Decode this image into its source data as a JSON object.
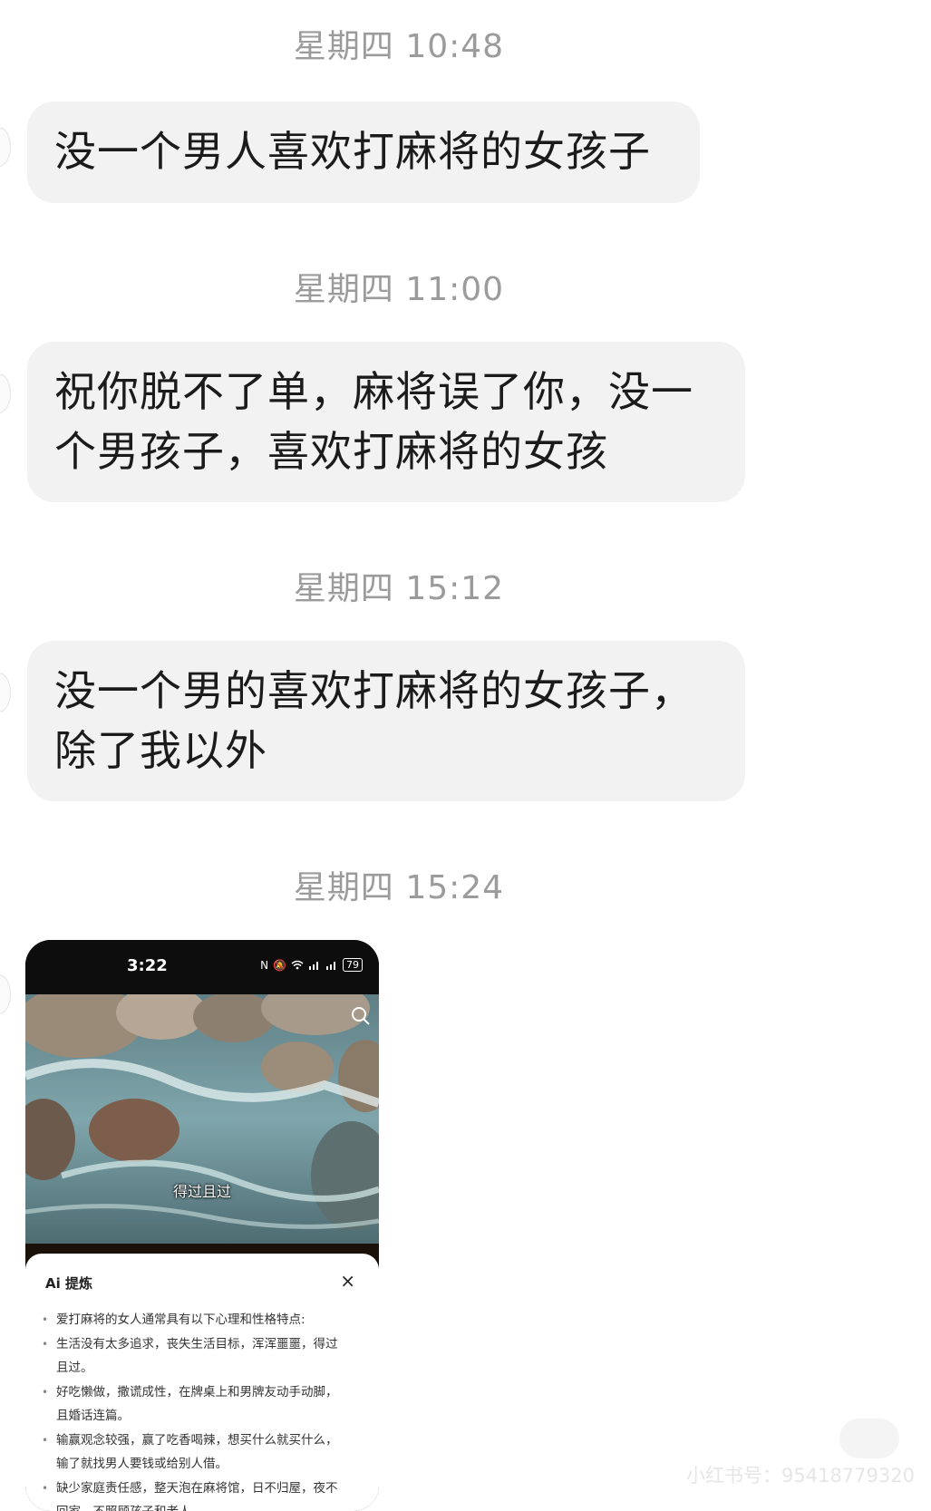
{
  "chat": {
    "messages": [
      {
        "timestamp": "星期四 10:48",
        "text": "没一个男人喜欢打麻将的女孩子"
      },
      {
        "timestamp": "星期四 11:00",
        "text": "祝你脱不了单，麻将误了你，没一个男孩子，喜欢打麻将的女孩"
      },
      {
        "timestamp": "星期四 15:12",
        "text": "没一个男的喜欢打麻将的女孩子，除了我以外"
      },
      {
        "timestamp": "星期四 15:24"
      }
    ]
  },
  "screenshot": {
    "status_time": "3:22",
    "battery": "79",
    "subtitle": "得过且过",
    "panel": {
      "title": "Ai 提炼",
      "close": "×",
      "items": [
        "爱打麻将的女人通常具有以下心理和性格特点:",
        "生活没有太多追求，丧失生活目标，浑浑噩噩，得过且过。",
        "好吃懒做，撒谎成性，在牌桌上和男牌友动手动脚，且婚话连篇。",
        "输赢观念较强，赢了吃香喝辣，想买什么就买什么，输了就找男人要钱或给别人借。",
        "缺少家庭责任感，整天泡在麻将馆，日不归屋，夜不回家，不照顾孩子和老人。"
      ]
    },
    "icons": [
      "search-icon",
      "wifi-icon",
      "signal-icon",
      "battery-icon"
    ]
  },
  "watermark": "小红书号：95418779320",
  "colors": {
    "bubble": "#f2f2f2",
    "timestamp": "#9b9b9b",
    "background": "#ffffff"
  }
}
